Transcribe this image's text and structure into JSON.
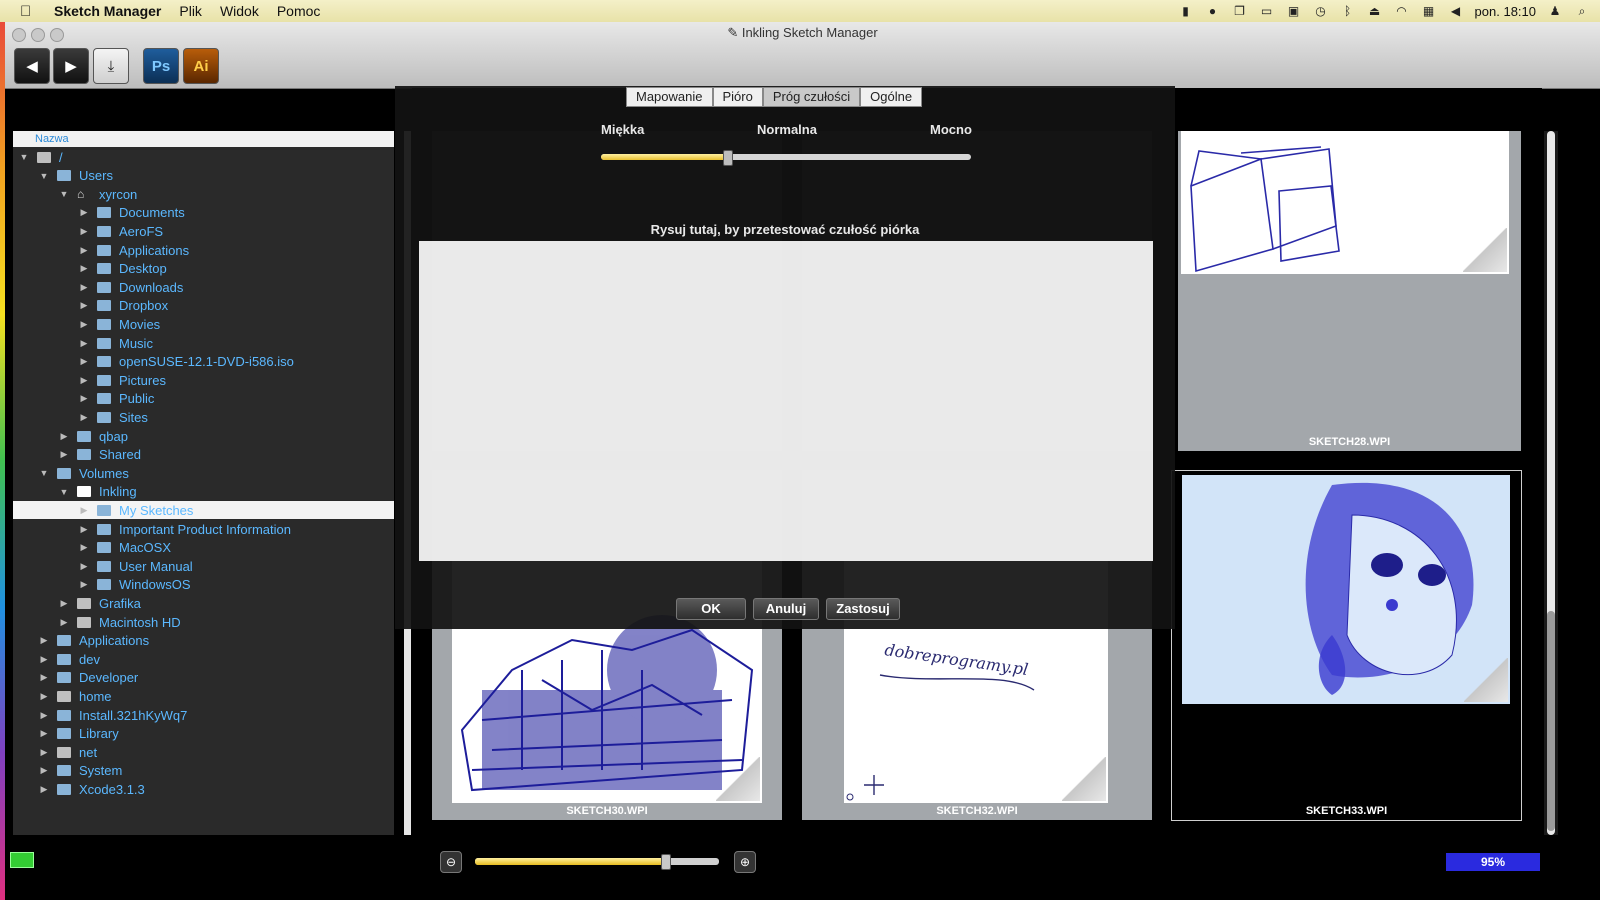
{
  "menubar": {
    "app_name": "Sketch Manager",
    "menus": [
      "Plik",
      "Widok",
      "Pomoc"
    ],
    "clock": "pon. 18:10"
  },
  "window": {
    "title": "Inkling Sketch Manager"
  },
  "toolbar": {
    "ps_label": "Ps",
    "ai_label": "Ai"
  },
  "sidebar": {
    "header": "Nazwa",
    "items": [
      {
        "label": "/",
        "icon": "disk-icon",
        "expanded": true
      },
      {
        "label": "Users",
        "icon": "folder-icon",
        "expanded": true
      },
      {
        "label": "xyrcon",
        "icon": "home-icon",
        "expanded": true
      },
      {
        "label": "Documents",
        "icon": "folder-icon"
      },
      {
        "label": "AeroFS",
        "icon": "folder-icon"
      },
      {
        "label": "Applications",
        "icon": "folder-icon"
      },
      {
        "label": "Desktop",
        "icon": "folder-icon"
      },
      {
        "label": "Downloads",
        "icon": "folder-icon"
      },
      {
        "label": "Dropbox",
        "icon": "folder-icon"
      },
      {
        "label": "Movies",
        "icon": "folder-icon"
      },
      {
        "label": "Music",
        "icon": "folder-icon"
      },
      {
        "label": "openSUSE-12.1-DVD-i586.iso",
        "icon": "folder-icon"
      },
      {
        "label": "Pictures",
        "icon": "folder-icon"
      },
      {
        "label": "Public",
        "icon": "folder-icon"
      },
      {
        "label": "Sites",
        "icon": "folder-icon"
      },
      {
        "label": "qbap",
        "icon": "folder-icon"
      },
      {
        "label": "Shared",
        "icon": "folder-icon"
      },
      {
        "label": "Volumes",
        "icon": "folder-icon",
        "expanded": true
      },
      {
        "label": "Inkling",
        "icon": "volume-icon",
        "expanded": true
      },
      {
        "label": "My Sketches",
        "icon": "folder-icon",
        "selected": true
      },
      {
        "label": "Important Product Information",
        "icon": "folder-icon"
      },
      {
        "label": "MacOSX",
        "icon": "folder-icon"
      },
      {
        "label": "User Manual",
        "icon": "folder-icon"
      },
      {
        "label": "WindowsOS",
        "icon": "folder-icon"
      },
      {
        "label": "Grafika",
        "icon": "disk-icon"
      },
      {
        "label": "Macintosh HD",
        "icon": "disk-icon"
      },
      {
        "label": "Applications",
        "icon": "folder-icon"
      },
      {
        "label": "dev",
        "icon": "folder-icon"
      },
      {
        "label": "Developer",
        "icon": "folder-icon"
      },
      {
        "label": "home",
        "icon": "disk-icon"
      },
      {
        "label": "Install.321hKyWq7",
        "icon": "folder-icon"
      },
      {
        "label": "Library",
        "icon": "folder-icon"
      },
      {
        "label": "net",
        "icon": "disk-icon"
      },
      {
        "label": "System",
        "icon": "folder-icon"
      },
      {
        "label": "Xcode3.1.3",
        "icon": "folder-icon"
      }
    ]
  },
  "sketches": {
    "sketch28": "SKETCH28.WPI",
    "sketch30": "SKETCH30.WPI",
    "sketch32": "SKETCH32.WPI",
    "sketch33": "SKETCH33.WPI",
    "sketch32_text": "dobreprogramy.pl"
  },
  "dialog": {
    "tabs": [
      "Mapowanie",
      "Pióro",
      "Próg czułości",
      "Ogólne"
    ],
    "active_tab": "Próg czułości",
    "label_soft": "Miękka",
    "label_normal": "Normalna",
    "label_strong": "Mocno",
    "threshold_fraction": 0.34,
    "draw_hint": "Rysuj tutaj, by przetestować czułość piórka",
    "ok": "OK",
    "cancel": "Anuluj",
    "apply": "Zastosuj"
  },
  "bottom": {
    "zoom_fraction": 0.78,
    "battery_percent": "95%"
  },
  "colors": {
    "accent_blue": "#5bb8ff",
    "slider_yellow": "#e8c030",
    "percent_bar": "#2a2adf"
  }
}
